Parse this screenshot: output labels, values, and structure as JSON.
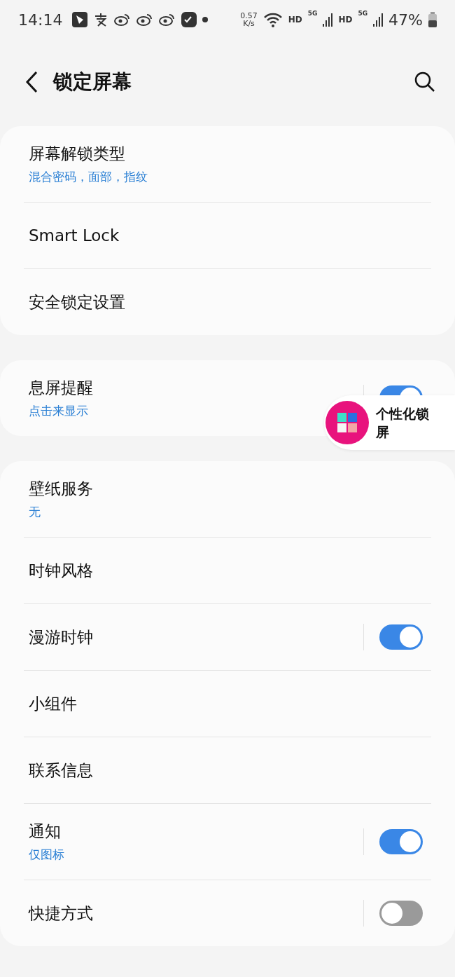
{
  "status_bar": {
    "time": "14:14",
    "speed_value": "0.57",
    "speed_unit": "K/s",
    "networks": [
      {
        "hd": "HD",
        "gen": "5G"
      },
      {
        "hd": "HD",
        "gen": "5G"
      }
    ],
    "battery": "47%"
  },
  "header": {
    "title": "锁定屏幕"
  },
  "groups": [
    {
      "rows": [
        {
          "kind": "nav",
          "title": "屏幕解锁类型",
          "subtitle": "混合密码，面部，指纹"
        },
        {
          "kind": "nav",
          "title": "Smart Lock"
        },
        {
          "kind": "nav",
          "title": "安全锁定设置"
        }
      ]
    },
    {
      "rows": [
        {
          "kind": "toggle",
          "title": "息屏提醒",
          "subtitle": "点击来显示",
          "on": true
        }
      ]
    },
    {
      "rows": [
        {
          "kind": "nav",
          "title": "壁纸服务",
          "subtitle": "无"
        },
        {
          "kind": "nav",
          "title": "时钟风格"
        },
        {
          "kind": "toggle",
          "title": "漫游时钟",
          "on": true
        },
        {
          "kind": "nav",
          "title": "小组件"
        },
        {
          "kind": "nav",
          "title": "联系信息"
        },
        {
          "kind": "toggle",
          "title": "通知",
          "subtitle": "仅图标",
          "on": true
        },
        {
          "kind": "toggle",
          "title": "快捷方式",
          "on": false
        }
      ]
    }
  ],
  "floating_shortcut": {
    "label": "个性化锁屏"
  }
}
